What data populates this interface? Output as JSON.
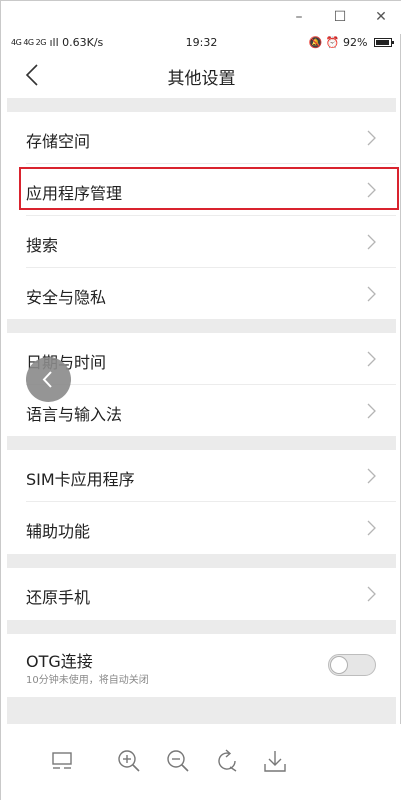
{
  "window_controls": {
    "minimize": "–",
    "maximize": "☐",
    "close": "✕"
  },
  "status_bar": {
    "signal": "4G 4G 2G",
    "network_speed": "0.63K/s",
    "time": "19:32",
    "battery": "92%"
  },
  "header": {
    "title": "其他设置"
  },
  "groups": [
    [
      {
        "label": "存储空间"
      },
      {
        "label": "应用程序管理",
        "highlighted": true
      },
      {
        "label": "搜索"
      },
      {
        "label": "安全与隐私"
      }
    ],
    [
      {
        "label": "日期与时间"
      },
      {
        "label": "语言与输入法"
      }
    ],
    [
      {
        "label": "SIM卡应用程序"
      },
      {
        "label": "辅助功能"
      }
    ],
    [
      {
        "label": "还原手机"
      }
    ],
    [
      {
        "label": "OTG连接",
        "sublabel": "10分钟未使用，将自动关闭",
        "toggle": false
      }
    ]
  ],
  "toolbar_icons": [
    "layout-icon",
    "zoom-in-icon",
    "zoom-out-icon",
    "rotate-icon",
    "download-icon"
  ],
  "colors": {
    "highlight": "#d9232e",
    "section_gap": "#ebebeb"
  }
}
